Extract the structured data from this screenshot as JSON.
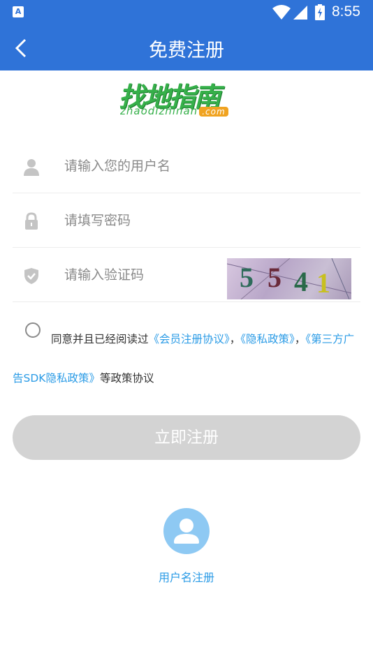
{
  "status_bar": {
    "notification_glyph": "A",
    "time": "8:55"
  },
  "header": {
    "title": "免费注册",
    "back_icon": "chevron-left-icon"
  },
  "logo": {
    "main_text": "找地指南",
    "sub_text": "zhaodizhinan",
    "com_text": ".com"
  },
  "form": {
    "username": {
      "placeholder": "请输入您的用户名",
      "icon": "user-icon"
    },
    "password": {
      "placeholder": "请填写密码",
      "icon": "lock-icon"
    },
    "captcha": {
      "placeholder": "请输入验证码",
      "icon": "shield-icon",
      "code": [
        "5",
        "5",
        "4",
        "1"
      ]
    }
  },
  "agreement": {
    "prefix": "同意并且已经阅读过",
    "link1": "《会员注册协议》",
    "sep1": "，",
    "link2": "《隐私政策》",
    "sep2": "，",
    "link3": "《第三方广告SDK隐私政策》",
    "suffix": "等政策协议"
  },
  "submit_label": "立即注册",
  "user_register_label": "用户名注册",
  "colors": {
    "primary": "#2f73d8",
    "link": "#2a9be6",
    "button_disabled": "#d3d3d3",
    "logo_green": "#36b04a"
  }
}
